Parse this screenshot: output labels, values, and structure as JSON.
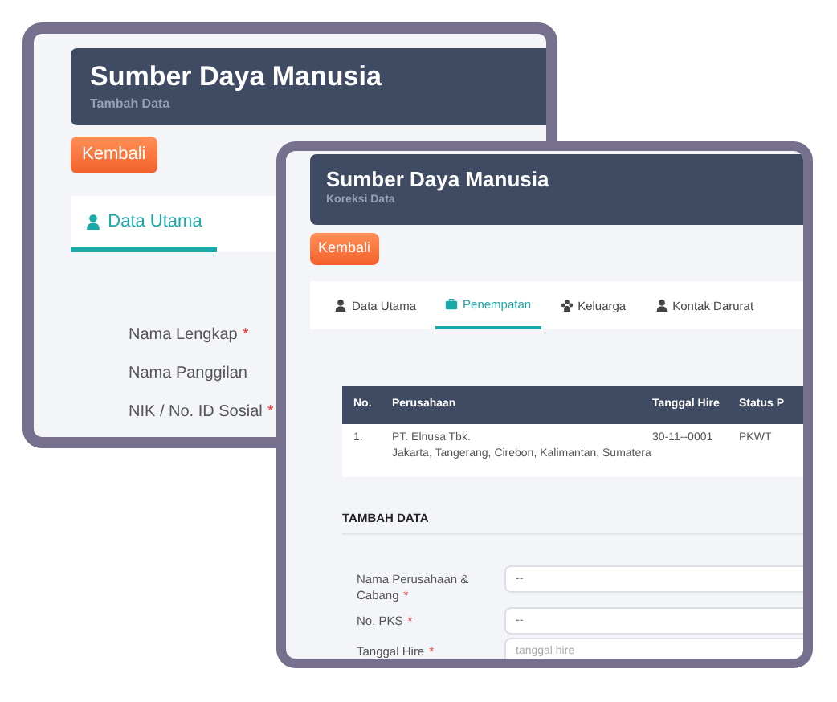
{
  "screens": [
    {
      "header": {
        "title": "Sumber Daya Manusia",
        "subtitle": "Tambah Data"
      },
      "back_button": "Kembali",
      "tabs": [
        {
          "label": "Data Utama",
          "selected": true
        }
      ],
      "fields": [
        {
          "label": "Nama Lengkap",
          "required_mark": "*"
        },
        {
          "label": "Nama Panggilan"
        },
        {
          "label": "NIK / No. ID Sosial",
          "required_mark": "*"
        }
      ]
    },
    {
      "header": {
        "title": "Sumber Daya Manusia",
        "subtitle": "Koreksi Data"
      },
      "back_button": "Kembali",
      "tabs": [
        {
          "label": "Data Utama",
          "selected": false
        },
        {
          "label": "Penempatan",
          "selected": true
        },
        {
          "label": "Keluarga",
          "selected": false
        },
        {
          "label": "Kontak Darurat",
          "selected": false
        }
      ],
      "table": {
        "columns": [
          "No.",
          "Perusahaan",
          "Tanggal Hire",
          "Status P"
        ],
        "rows": [
          {
            "no": "1.",
            "company": "PT. Elnusa Tbk.",
            "locations": "Jakarta, Tangerang, Cirebon, Kalimantan, Sumatera",
            "hire_date": "30-11--0001",
            "status": "PKWT"
          }
        ]
      },
      "section_title": "TAMBAH DATA",
      "form": [
        {
          "label": "Nama Perusahaan & Cabang",
          "required_mark": "*",
          "value": "--"
        },
        {
          "label": "No. PKS",
          "required_mark": "*",
          "value": "--"
        },
        {
          "label": "Tanggal Hire",
          "required_mark": "*",
          "placeholder": "tanggal hire"
        }
      ]
    }
  ]
}
